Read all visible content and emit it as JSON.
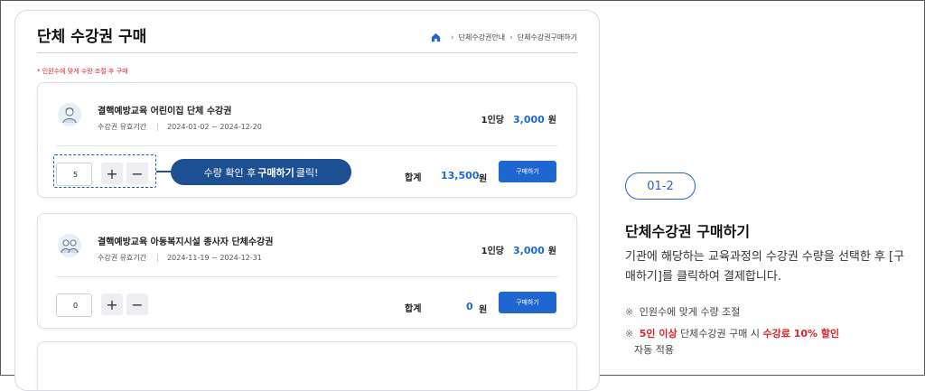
{
  "page": {
    "title": "단체 수강권 구매",
    "breadcrumb": [
      "단체수강권안내",
      "단체수강권구매하기"
    ],
    "notice": "* 인원수에 맞게 수량 조절 후 구매"
  },
  "cards": [
    {
      "name": "결핵예방교육 어린이집 단체 수강권",
      "period_label": "수강권 유효기간",
      "period": "2024-01-02 ~ 2024-12-20",
      "unit_label": "1인당",
      "price": "3,000",
      "currency": "원",
      "quantity": "5",
      "total_label": "합계",
      "total": "13,500",
      "buy_label": "구매하기",
      "icon": "child-icon"
    },
    {
      "name": "결핵예방교육 아동복지시설 종사자 단체수강권",
      "period_label": "수강권 유효기간",
      "period": "2024-11-19 ~ 2024-12-31",
      "unit_label": "1인당",
      "price": "3,000",
      "currency": "원",
      "quantity": "0",
      "total_label": "합계",
      "total": "0",
      "buy_label": "구매하기",
      "icon": "group-icon"
    }
  ],
  "qty_plus": "+",
  "qty_minus": "−",
  "callout": {
    "before": "수량 확인 후",
    "bold": "구매하기",
    "after": "클릭!"
  },
  "guide": {
    "step": "01-2",
    "title": "단체수강권 구매하기",
    "description": "기관에 해당하는 교육과정의 수강권 수량을 선택한 후 [구매하기]를 클릭하여 결제합니다.",
    "note_mark": "※",
    "note1": "인원수에 맞게 수량 조절",
    "note2_red1": "5인 이상",
    "note2_mid": "단체수강권 구매 시",
    "note2_red2": "수강료 10% 할인",
    "note2_end": "자동 적용"
  },
  "colors": {
    "accent": "#1f66d1",
    "callout": "#1d4f93",
    "warning": "#e0222a"
  }
}
